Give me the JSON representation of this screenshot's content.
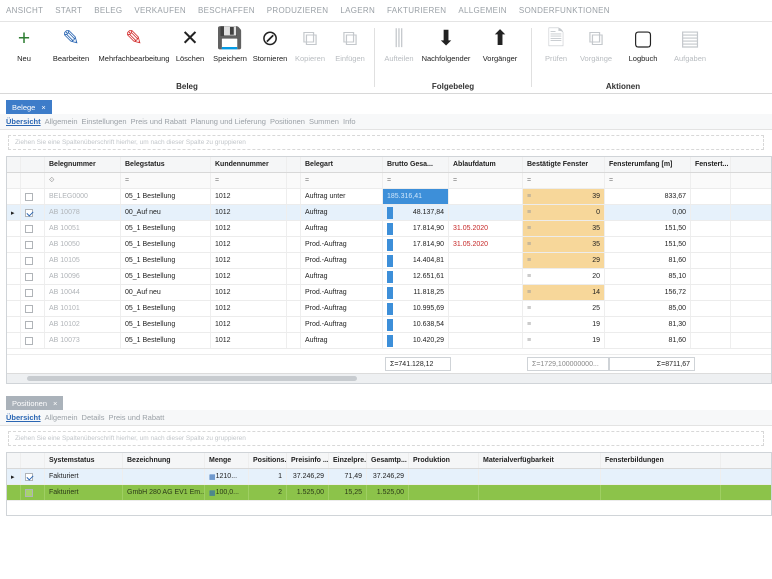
{
  "menu": [
    "ANSICHT",
    "START",
    "BELEG",
    "VERKAUFEN",
    "BESCHAFFEN",
    "PRODUZIEREN",
    "LAGERN",
    "FAKTURIEREN",
    "ALLGEMEIN",
    "SONDERFUNKTIONEN"
  ],
  "ribbon": {
    "beleg_group": {
      "caption": "Beleg",
      "buttons": [
        {
          "label": "Neu",
          "icon": "plus-icon",
          "glyph": "+",
          "color": "#2e7d32",
          "enabled": true
        },
        {
          "label": "Bearbeiten",
          "icon": "pen-icon",
          "glyph": "✎",
          "color": "#2a66b3",
          "enabled": true
        },
        {
          "label": "Mehrfachbearbeitung",
          "icon": "multi-pen-icon",
          "glyph": "✎",
          "color": "#d32f2f",
          "enabled": true
        },
        {
          "label": "Löschen",
          "icon": "delete-x-icon",
          "glyph": "✕",
          "color": "#222222",
          "enabled": true
        },
        {
          "label": "Speichern",
          "icon": "save-icon",
          "glyph": "💾",
          "color": "#222222",
          "enabled": true
        },
        {
          "label": "Stornieren",
          "icon": "cancel-circle-icon",
          "glyph": "⊘",
          "color": "#222222",
          "enabled": true
        },
        {
          "label": "Kopieren",
          "icon": "copy-icon",
          "glyph": "⧉",
          "color": "#c4c8cc",
          "enabled": false
        },
        {
          "label": "Einfügen",
          "icon": "paste-icon",
          "glyph": "⧉",
          "color": "#c4c8cc",
          "enabled": false
        }
      ]
    },
    "folgebeleg_group": {
      "caption": "Folgebeleg",
      "buttons": [
        {
          "label": "Aufteilen",
          "icon": "split-icon",
          "glyph": "⫼",
          "color": "#c4c8cc",
          "enabled": false
        },
        {
          "label": "Nachfolgender",
          "icon": "arrow-down-icon",
          "glyph": "⬇",
          "color": "#222222",
          "enabled": true
        },
        {
          "label": "Vorgänger",
          "icon": "arrow-up-icon",
          "glyph": "⬆",
          "color": "#222222",
          "enabled": true
        }
      ]
    },
    "aktionen_group": {
      "caption": "Aktionen",
      "buttons": [
        {
          "label": "Prüfen",
          "icon": "check-doc-icon",
          "glyph": "🗎",
          "color": "#c4c8cc",
          "enabled": false
        },
        {
          "label": "Vorgänge",
          "icon": "doc-copy-icon",
          "glyph": "⧉",
          "color": "#c4c8cc",
          "enabled": false
        },
        {
          "label": "Logbuch",
          "icon": "logbook-icon",
          "glyph": "▢",
          "color": "#222222",
          "enabled": true
        },
        {
          "label": "Aufgaben",
          "icon": "tasks-icon",
          "glyph": "▤",
          "color": "#c4c8cc",
          "enabled": false
        }
      ]
    }
  },
  "top_panel": {
    "tab_label": "Belege",
    "close_glyph": "×",
    "subtabs": [
      "Übersicht",
      "Allgemein",
      "Einstellungen",
      "Preis und Rabatt",
      "Planung und Lieferung",
      "Positionen",
      "Summen",
      "Info"
    ],
    "group_hint": "Ziehen Sie eine Spaltenüberschrift hierher, um nach dieser Spalte zu gruppieren",
    "columns": [
      "",
      "",
      "Belegnummer",
      "Belegstatus",
      "Kundennummer",
      "",
      "Belegart",
      "Brutto Gesa...",
      "Ablaufdatum",
      "Bestätigte Fenster",
      "Fensterumfang [m]",
      "Fenstert..."
    ],
    "filter_row": [
      "",
      "",
      "⟐",
      "=",
      "=",
      "",
      "=",
      "=",
      "=",
      "=",
      "=",
      ""
    ],
    "rows": [
      {
        "sel": false,
        "checked": false,
        "nr": "BELEG0000",
        "status": "05_1 Bestellung",
        "kunde": "1012",
        "art": "Auftrag unter",
        "brutto": "185.316,41",
        "ablauf": "",
        "fenster": "39",
        "fenster_hl": true,
        "umfang": "833,67"
      },
      {
        "sel": true,
        "checked": true,
        "nr": "AB 10078",
        "status": "00_Auf neu",
        "kunde": "1012",
        "art": "Auftrag",
        "brutto": "48.137,84",
        "ablauf": "",
        "fenster": "0",
        "fenster_hl": true,
        "umfang": "0,00"
      },
      {
        "sel": false,
        "checked": false,
        "nr": "AB 10051",
        "status": "05_1 Bestellung",
        "kunde": "1012",
        "art": "Auftrag",
        "brutto": "17.814,90",
        "ablauf": "31.05.2020",
        "fenster": "35",
        "fenster_hl": true,
        "umfang": "151,50"
      },
      {
        "sel": false,
        "checked": false,
        "nr": "AB 10050",
        "status": "05_1 Bestellung",
        "kunde": "1012",
        "art": "Prod.-Auftrag",
        "brutto": "17.814,90",
        "ablauf": "31.05.2020",
        "fenster": "35",
        "fenster_hl": true,
        "umfang": "151,50"
      },
      {
        "sel": false,
        "checked": false,
        "nr": "AB 10105",
        "status": "05_1 Bestellung",
        "kunde": "1012",
        "art": "Prod.-Auftrag",
        "brutto": "14.404,81",
        "ablauf": "",
        "fenster": "29",
        "fenster_hl": true,
        "umfang": "81,60"
      },
      {
        "sel": false,
        "checked": false,
        "nr": "AB 10096",
        "status": "05_1 Bestellung",
        "kunde": "1012",
        "art": "Auftrag",
        "brutto": "12.651,61",
        "ablauf": "",
        "fenster": "20",
        "fenster_hl": false,
        "umfang": "85,10"
      },
      {
        "sel": false,
        "checked": false,
        "nr": "AB 10044",
        "status": "00_Auf neu",
        "kunde": "1012",
        "art": "Prod.-Auftrag",
        "brutto": "11.818,25",
        "ablauf": "",
        "fenster": "14",
        "fenster_hl": true,
        "umfang": "156,72"
      },
      {
        "sel": false,
        "checked": false,
        "nr": "AB 10101",
        "status": "05_1 Bestellung",
        "kunde": "1012",
        "art": "Prod.-Auftrag",
        "brutto": "10.995,69",
        "ablauf": "",
        "fenster": "25",
        "fenster_hl": false,
        "umfang": "85,00"
      },
      {
        "sel": false,
        "checked": false,
        "nr": "AB 10102",
        "status": "05_1 Bestellung",
        "kunde": "1012",
        "art": "Prod.-Auftrag",
        "brutto": "10.638,54",
        "ablauf": "",
        "fenster": "19",
        "fenster_hl": false,
        "umfang": "81,30"
      },
      {
        "sel": false,
        "checked": false,
        "nr": "AB 10073",
        "status": "05_1 Bestellung",
        "kunde": "1012",
        "art": "Auftrag",
        "brutto": "10.420,29",
        "ablauf": "",
        "fenster": "19",
        "fenster_hl": false,
        "umfang": "81,60"
      }
    ],
    "sum_brutto": "Σ=741.128,12",
    "sum_fenster": "Σ=1729,100000000...",
    "sum_umfang": "Σ=8711,67"
  },
  "bottom_panel": {
    "tab_label": "Positionen",
    "close_glyph": "×",
    "subtabs": [
      "Übersicht",
      "Allgemein",
      "Details",
      "Preis und Rabatt"
    ],
    "group_hint": "Ziehen Sie eine Spaltenüberschrift hierher, um nach dieser Spalte zu gruppieren",
    "columns": [
      "",
      "",
      "Systemstatus",
      "Bezeichnung",
      "Menge",
      "Positions...",
      "Preisinfo ...",
      "Einzelpre...",
      "Gesamtp...",
      "Produktion",
      "Materialverfügbarkeit",
      "Fensterbildungen"
    ],
    "rows": [
      {
        "green": false,
        "checked": true,
        "status": "Fakturiert",
        "bez": "",
        "menge": "1210...",
        "pos": "1",
        "preis": "37.246,29",
        "einzel": "71,49",
        "gesamt": "37.246,29"
      },
      {
        "green": true,
        "checked": false,
        "status": "Fakturiert",
        "bez": "GmbH 280 AG EV1 Em...",
        "menge": "100,0...",
        "pos": "2",
        "preis": "1.525,00",
        "einzel": "15,25",
        "gesamt": "1.525,00"
      }
    ]
  }
}
